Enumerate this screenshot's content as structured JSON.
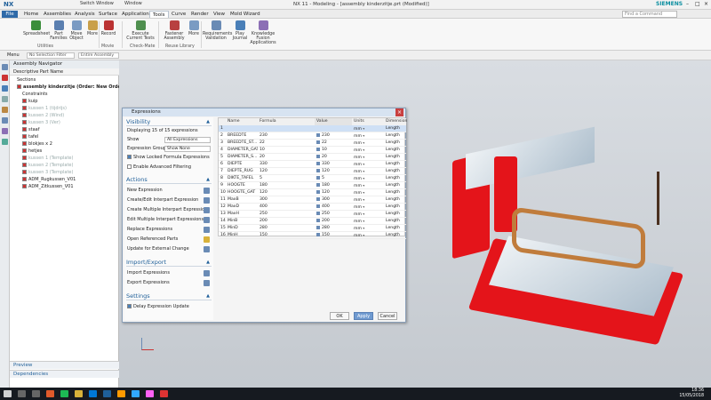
{
  "titlebar": {
    "app": "NX",
    "switch_window": "Switch Window",
    "window_menu": "Window",
    "title": "NX 11 - Modeling - [assembly kinderzitje.prt (Modified)]",
    "brand": "SIEMENS"
  },
  "menubar": {
    "items": [
      "File",
      "Home",
      "Assemblies",
      "Analysis",
      "Surface",
      "Application",
      "Tools",
      "Curve",
      "Render",
      "View",
      "Mold Wizard"
    ],
    "search_placeholder": "Find a Command"
  },
  "ribbon": {
    "buttons": [
      "Spreadsheet",
      "Part Families",
      "Move Object",
      "More",
      "Record",
      "Execute Current Tests",
      "Fastener Assembly",
      "More",
      "Requirements Validation",
      "Play Journal",
      "Knowledge Fusion Applications"
    ],
    "groups": [
      "Utilities",
      "Movie",
      "Check-Mate",
      "Reuse Library"
    ]
  },
  "toolbar2": {
    "menu": "Menu",
    "filter": "No Selection Filter",
    "scope": "Entire Assembly"
  },
  "navigator": {
    "title": "Assembly Navigator",
    "column": "Descriptive Part Name",
    "items": [
      {
        "label": "Sections",
        "dim": false
      },
      {
        "label": "assembly kinderzitje (Order: New Order 1)",
        "dim": false,
        "bold": true
      },
      {
        "label": "Constraints",
        "dim": false
      },
      {
        "label": "kuip",
        "dim": false
      },
      {
        "label": "kussen 1 (tijdrijs)",
        "dim": true
      },
      {
        "label": "kussen 2 (Wind)",
        "dim": true
      },
      {
        "label": "kussen 3 (Ver)",
        "dim": true
      },
      {
        "label": "staaf",
        "dim": false
      },
      {
        "label": "tafel",
        "dim": false
      },
      {
        "label": "blokjes x 2",
        "dim": false
      },
      {
        "label": "hetjes",
        "dim": false
      },
      {
        "label": "kussen 1 (Template)",
        "dim": true
      },
      {
        "label": "kussen 2 (Template)",
        "dim": true
      },
      {
        "label": "kussen 3 (Template)",
        "dim": true
      },
      {
        "label": "ADM_Rugkussen_V01",
        "dim": false
      },
      {
        "label": "ADM_Zitkussen_V01",
        "dim": false
      }
    ],
    "preview": "Preview",
    "dependencies": "Dependencies"
  },
  "dialog": {
    "title": "Expressions",
    "visibility": {
      "heading": "Visibility",
      "displaying": "Displaying 15 of 15 expressions",
      "show_label": "Show",
      "show_value": "All Expressions",
      "groups_label": "Expression Groups",
      "groups_value": "Show None",
      "locked": "Show Locked Formula Expressions",
      "advanced": "Enable Advanced Filtering"
    },
    "actions": {
      "heading": "Actions",
      "items": [
        "New Expression",
        "Create/Edit Interpart Expression",
        "Create Multiple Interpart Expressions",
        "Edit Multiple Interpart Expressions",
        "Replace Expressions",
        "Open Referenced Parts",
        "Update for External Change"
      ]
    },
    "import_export": {
      "heading": "Import/Export",
      "items": [
        "Import Expressions",
        "Export Expressions"
      ]
    },
    "settings": {
      "heading": "Settings",
      "delay": "Delay Expression Update"
    },
    "columns": [
      "",
      "Name",
      "Formula",
      "",
      "Value",
      "Units",
      "",
      "Dimension"
    ],
    "rows": [
      {
        "n": "1",
        "name": "",
        "formula": "",
        "value": "",
        "units": "mm",
        "dim": "Length"
      },
      {
        "n": "2",
        "name": "BREEDTE",
        "formula": "230",
        "value": "230",
        "units": "mm",
        "dim": "Length"
      },
      {
        "n": "3",
        "name": "BREEDTE_ST...",
        "formula": "22",
        "value": "22",
        "units": "mm",
        "dim": "Length"
      },
      {
        "n": "4",
        "name": "DIAMETER_GAT",
        "formula": "10",
        "value": "10",
        "units": "mm",
        "dim": "Length"
      },
      {
        "n": "5",
        "name": "DIAMETER_S...",
        "formula": "20",
        "value": "20",
        "units": "mm",
        "dim": "Length"
      },
      {
        "n": "6",
        "name": "DIEPTE",
        "formula": "330",
        "value": "330",
        "units": "mm",
        "dim": "Length"
      },
      {
        "n": "7",
        "name": "DIEPTE_RUG",
        "formula": "120",
        "value": "120",
        "units": "mm",
        "dim": "Length"
      },
      {
        "n": "8",
        "name": "DIKTE_TAFEL",
        "formula": "5",
        "value": "5",
        "units": "mm",
        "dim": "Length"
      },
      {
        "n": "9",
        "name": "HOOGTE",
        "formula": "180",
        "value": "180",
        "units": "mm",
        "dim": "Length"
      },
      {
        "n": "10",
        "name": "HOOGTE_GAT",
        "formula": "120",
        "value": "120",
        "units": "mm",
        "dim": "Length"
      },
      {
        "n": "11",
        "name": "MaxB",
        "formula": "300",
        "value": "300",
        "units": "mm",
        "dim": "Length"
      },
      {
        "n": "12",
        "name": "MaxD",
        "formula": "400",
        "value": "400",
        "units": "mm",
        "dim": "Length"
      },
      {
        "n": "13",
        "name": "MaxH",
        "formula": "250",
        "value": "250",
        "units": "mm",
        "dim": "Length"
      },
      {
        "n": "14",
        "name": "MinB",
        "formula": "200",
        "value": "200",
        "units": "mm",
        "dim": "Length"
      },
      {
        "n": "15",
        "name": "MinD",
        "formula": "280",
        "value": "280",
        "units": "mm",
        "dim": "Length"
      },
      {
        "n": "16",
        "name": "MinH",
        "formula": "150",
        "value": "150",
        "units": "mm",
        "dim": "Length"
      }
    ],
    "ok": "OK",
    "apply": "Apply",
    "cancel": "Cancel"
  },
  "taskbar": {
    "time": "18:36",
    "date": "15/05/2018"
  }
}
